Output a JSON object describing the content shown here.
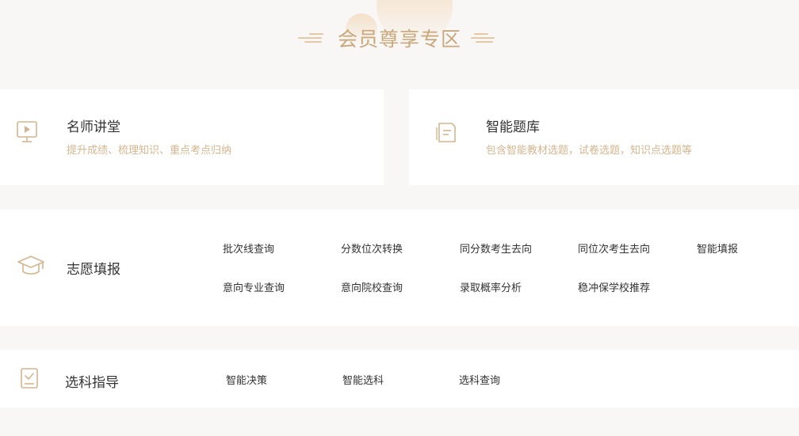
{
  "header": {
    "title": "会员尊享专区"
  },
  "cards": {
    "teacher": {
      "icon": "video-play-icon",
      "title": "名师讲堂",
      "desc": "提升成绩、梳理知识、重点考点归纳"
    },
    "bank": {
      "icon": "document-stack-icon",
      "title": "智能题库",
      "desc": "包含智能教材选题，试卷选题，知识点选题等"
    },
    "volunteer": {
      "icon": "graduation-cap-icon",
      "title": "志愿填报",
      "links": [
        "批次线查询",
        "分数位次转换",
        "同分数考生去向",
        "同位次考生去向",
        "智能填报",
        "意向专业查询",
        "意向院校查询",
        "录取概率分析",
        "稳冲保学校推荐"
      ]
    },
    "subject": {
      "icon": "checkbox-doc-icon",
      "title": "选科指导",
      "links": [
        "智能决策",
        "智能选科",
        "选科查询"
      ]
    }
  },
  "colors": {
    "accent": "#c9a87b",
    "desc": "#d3b68f",
    "text": "#333333",
    "background": "#f8f7f6"
  }
}
